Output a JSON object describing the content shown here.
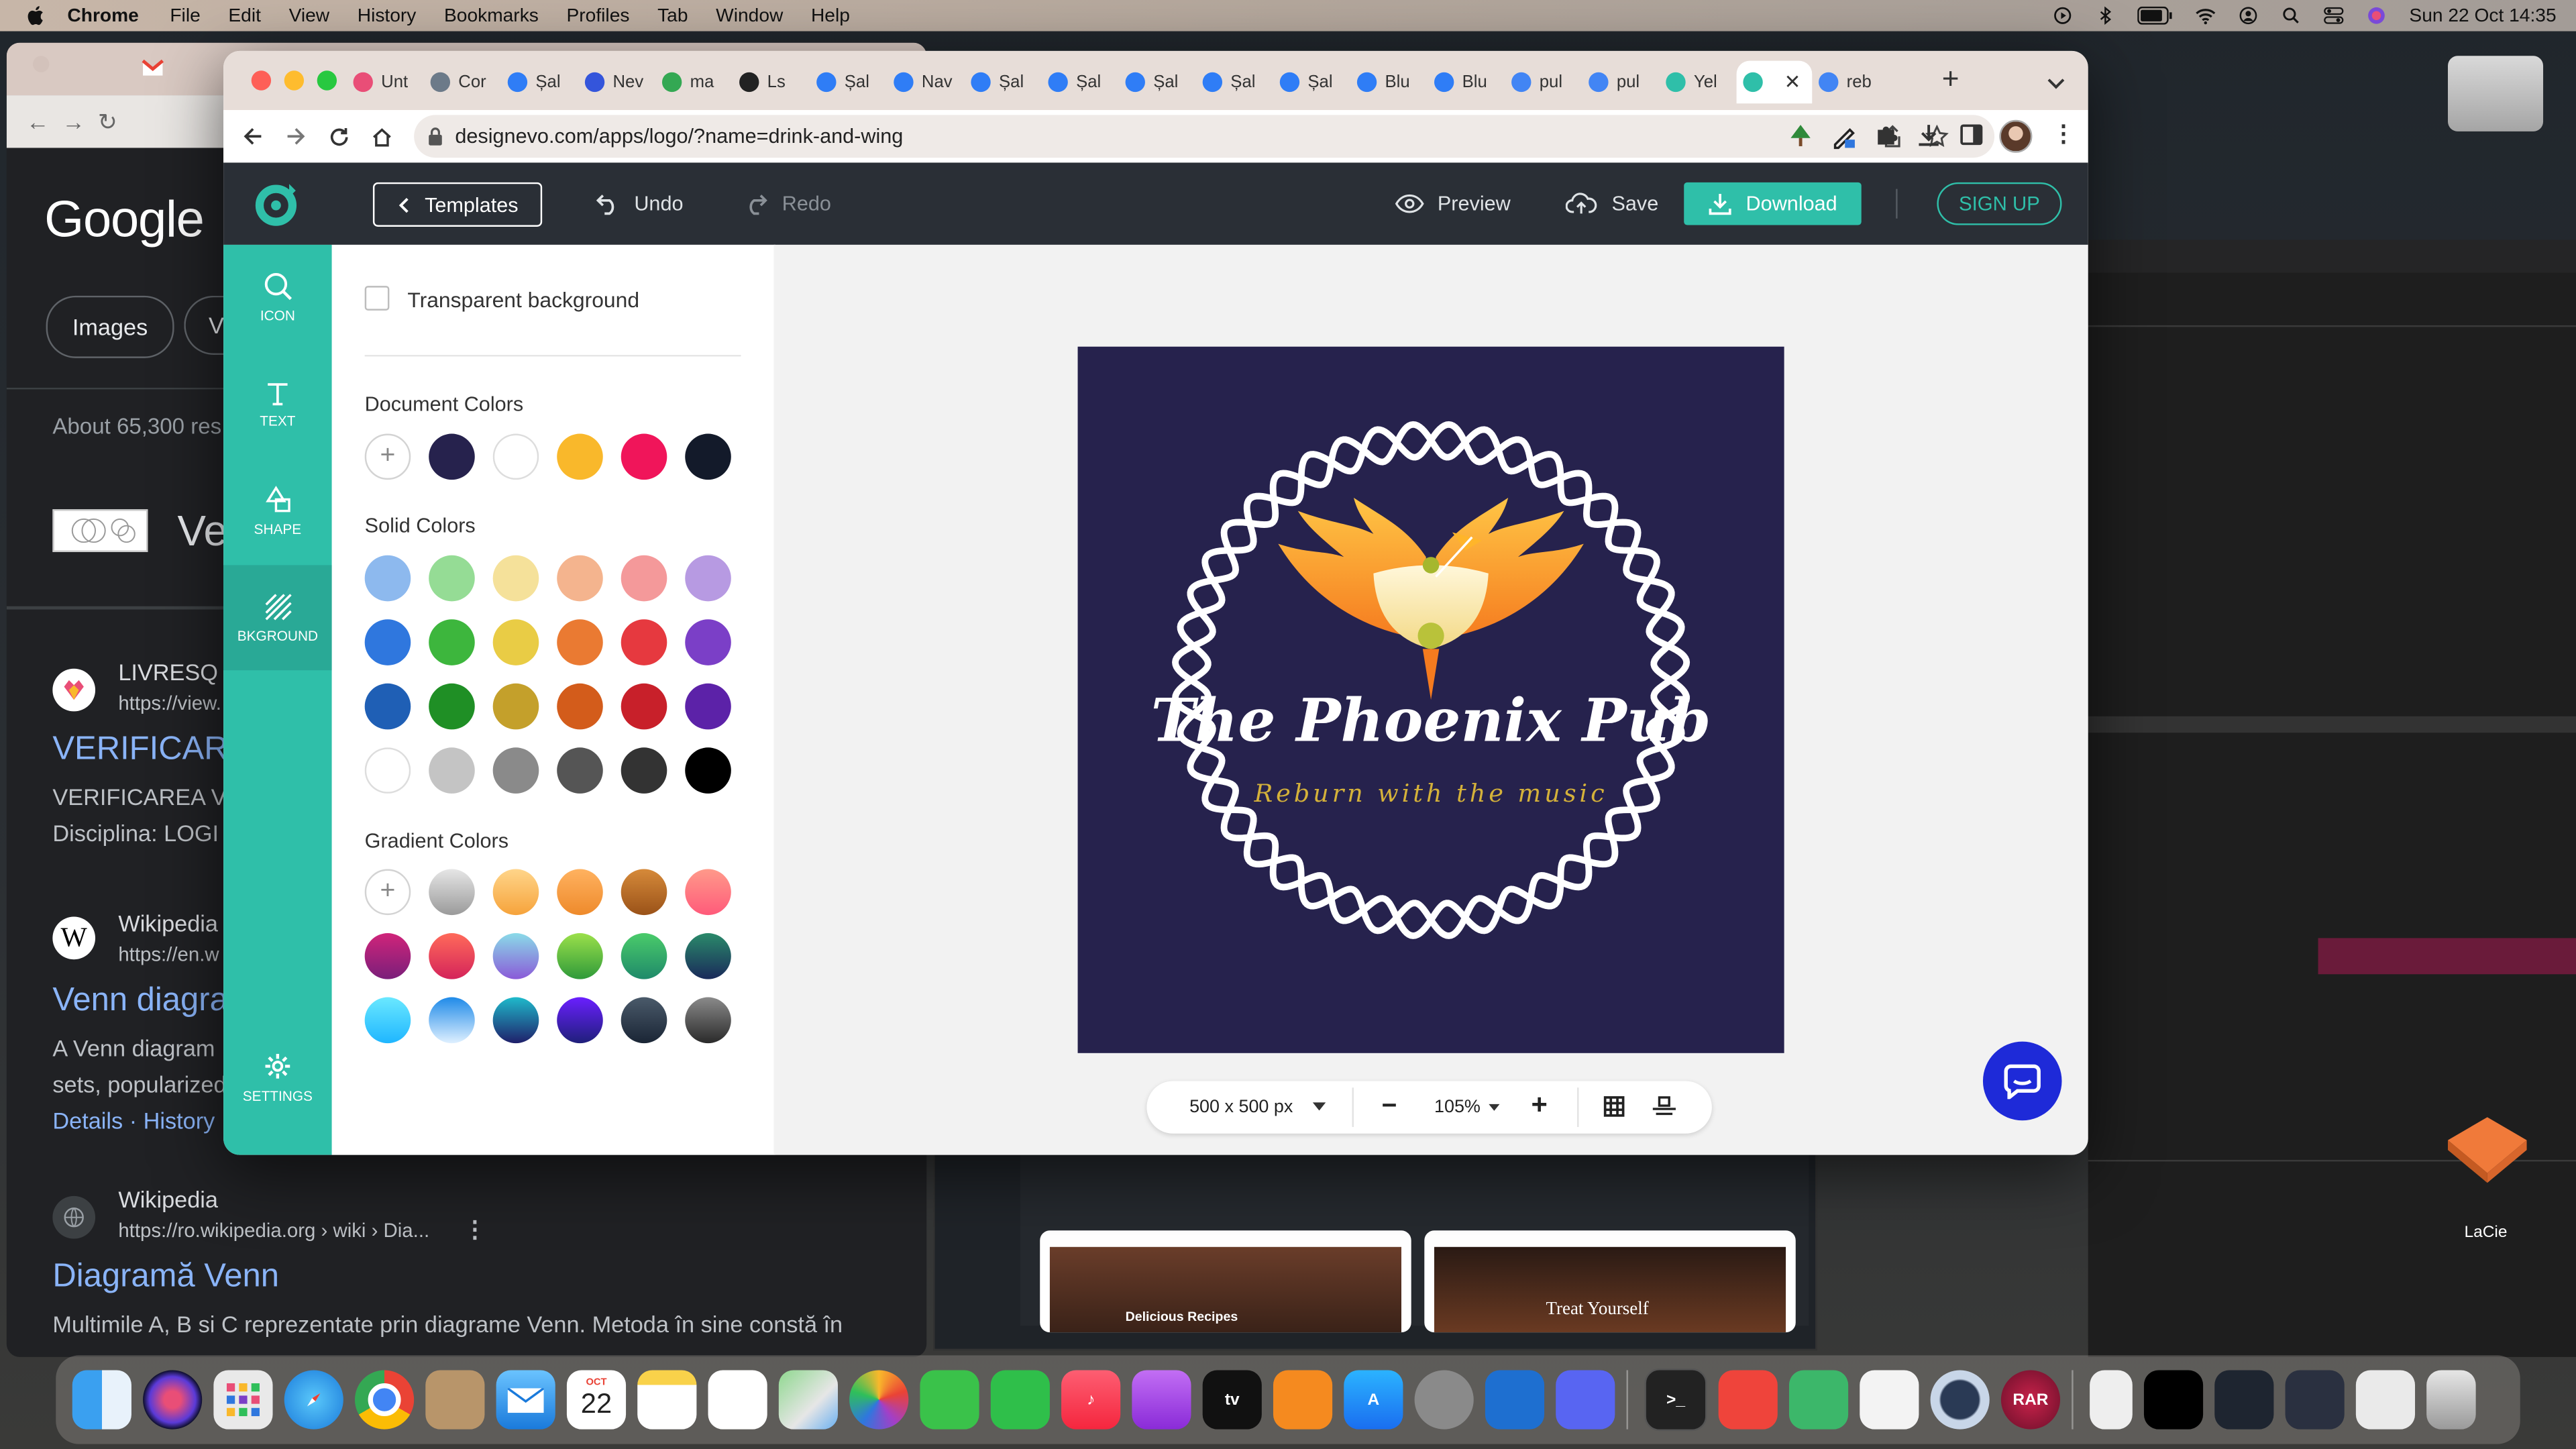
{
  "menubar": {
    "app": "Chrome",
    "items": [
      "File",
      "Edit",
      "View",
      "History",
      "Bookmarks",
      "Profiles",
      "Tab",
      "Window",
      "Help"
    ],
    "datetime": "Sun 22 Oct  14:35"
  },
  "background_window": {
    "google_logo": "Google",
    "chips": [
      "Images",
      "V"
    ],
    "results_count": "About 65,300 res",
    "heading_fragment": "Ve",
    "results": [
      {
        "site": "LIVRESQ",
        "url": "https://view.",
        "title": "VERIFICAR",
        "snippet": [
          "VERIFICAREA V",
          "Disciplina: LOGI"
        ]
      },
      {
        "site": "Wikipedia",
        "url": "https://en.w",
        "title": "Venn diagra",
        "snippet": [
          "A Venn diagram",
          "sets, popularized"
        ],
        "links": "Details · History"
      },
      {
        "site": "Wikipedia",
        "url": "https://ro.wikipedia.org › wiki › Dia...",
        "title": "Diagramă Venn",
        "snippet": [
          "Multimile A, B si C reprezentate prin diagrame Venn. Metoda în sine constă în"
        ]
      }
    ],
    "thumb_captions": [
      "Delicious Recipes",
      "Treat Yourself"
    ],
    "lacie_label": "LaCie"
  },
  "browser": {
    "tabs": [
      {
        "title": "Unt",
        "color": "#e94e77"
      },
      {
        "title": "Cor",
        "color": "#6c7a89"
      },
      {
        "title": "Șal",
        "color": "#2f7df6"
      },
      {
        "title": "Nev",
        "color": "#3455db"
      },
      {
        "title": "ma",
        "color": "#34a853"
      },
      {
        "title": "Ls",
        "color": "#222222"
      },
      {
        "title": "Șal",
        "color": "#2f7df6"
      },
      {
        "title": "Nav",
        "color": "#2f7df6"
      },
      {
        "title": "Șal",
        "color": "#2f7df6"
      },
      {
        "title": "Șal",
        "color": "#2f7df6"
      },
      {
        "title": "Șal",
        "color": "#2f7df6"
      },
      {
        "title": "Șal",
        "color": "#2f7df6"
      },
      {
        "title": "Șal",
        "color": "#2f7df6"
      },
      {
        "title": "Blu",
        "color": "#2f7df6"
      },
      {
        "title": "Blu",
        "color": "#2f7df6"
      },
      {
        "title": "pul",
        "color": "#4285f4"
      },
      {
        "title": "pul",
        "color": "#4285f4"
      },
      {
        "title": "Yel",
        "color": "#2fbfa9"
      },
      {
        "title": "",
        "color": "#2fbfa9",
        "active": true
      },
      {
        "title": "reb",
        "color": "#4285f4"
      }
    ],
    "url": "designevo.com/apps/logo/?name=drink-and-wing"
  },
  "app": {
    "templates_label": "Templates",
    "undo_label": "Undo",
    "redo_label": "Redo",
    "preview_label": "Preview",
    "save_label": "Save",
    "download_label": "Download",
    "signup_label": "SIGN UP",
    "nav": [
      {
        "label": "ICON",
        "icon": "search-icon"
      },
      {
        "label": "TEXT",
        "icon": "text-icon"
      },
      {
        "label": "SHAPE",
        "icon": "shape-icon"
      },
      {
        "label": "BKGROUND",
        "icon": "background-icon",
        "active": true
      },
      {
        "label": "SETTINGS",
        "icon": "gear-icon"
      }
    ],
    "panel": {
      "transparent_label": "Transparent background",
      "document_colors_title": "Document Colors",
      "document_colors": [
        "#26224d",
        "#ffffff",
        "#f9b82b",
        "#f0155a",
        "#131a2a"
      ],
      "solid_colors_title": "Solid Colors",
      "solid_colors": [
        [
          "#8db9ee",
          "#95dc95",
          "#f5e19a",
          "#f4b48e",
          "#f4999a",
          "#b79ae2"
        ],
        [
          "#2f77de",
          "#3db63d",
          "#e9cc45",
          "#ea7a32",
          "#e6393f",
          "#7b3fc7"
        ],
        [
          "#1f5fb5",
          "#1f8f25",
          "#c4a02b",
          "#d35c1b",
          "#c8202a",
          "#5c22a8"
        ],
        [
          "#ffffff",
          "#c4c4c4",
          "#8a8a8a",
          "#555555",
          "#333333",
          "#000000"
        ]
      ],
      "gradient_colors_title": "Gradient Colors",
      "gradient_colors": [
        [
          null,
          [
            "#e6e6e6",
            "#9a9a9a"
          ],
          [
            "#ffd58a",
            "#f6a33b"
          ],
          [
            "#ffb260",
            "#ee8a2b"
          ],
          [
            "#d68a3a",
            "#9a5218"
          ],
          [
            "#ff9a8a",
            "#ff5a7a"
          ]
        ],
        [
          [
            "#d0247a",
            "#7a1f7a"
          ],
          [
            "#ff6a5a",
            "#d4245a"
          ],
          [
            "#8adbe8",
            "#8a5ad8"
          ],
          [
            "#9be04a",
            "#2f9a3a"
          ],
          [
            "#4acb6a",
            "#1f8a6a"
          ],
          [
            "#2a8a6a",
            "#1a2a5a"
          ]
        ],
        [
          [
            "#6ae8ff",
            "#1fb6ff"
          ],
          [
            "#1f8ae8",
            "#dff0ff"
          ],
          [
            "#1fbacb",
            "#1f1f6a"
          ],
          [
            "#6a1fff",
            "#1f1f7a"
          ],
          [
            "#4a5a6a",
            "#1a2535"
          ],
          [
            "#8a8a8a",
            "#2a2a2a"
          ]
        ]
      ]
    },
    "logo": {
      "bg_color": "#26224d",
      "title": "The Phoenix Pub",
      "subtitle": "Reburn with the music"
    },
    "bottombar": {
      "size_label": "500 x 500 px",
      "zoom_label": "105%"
    }
  }
}
